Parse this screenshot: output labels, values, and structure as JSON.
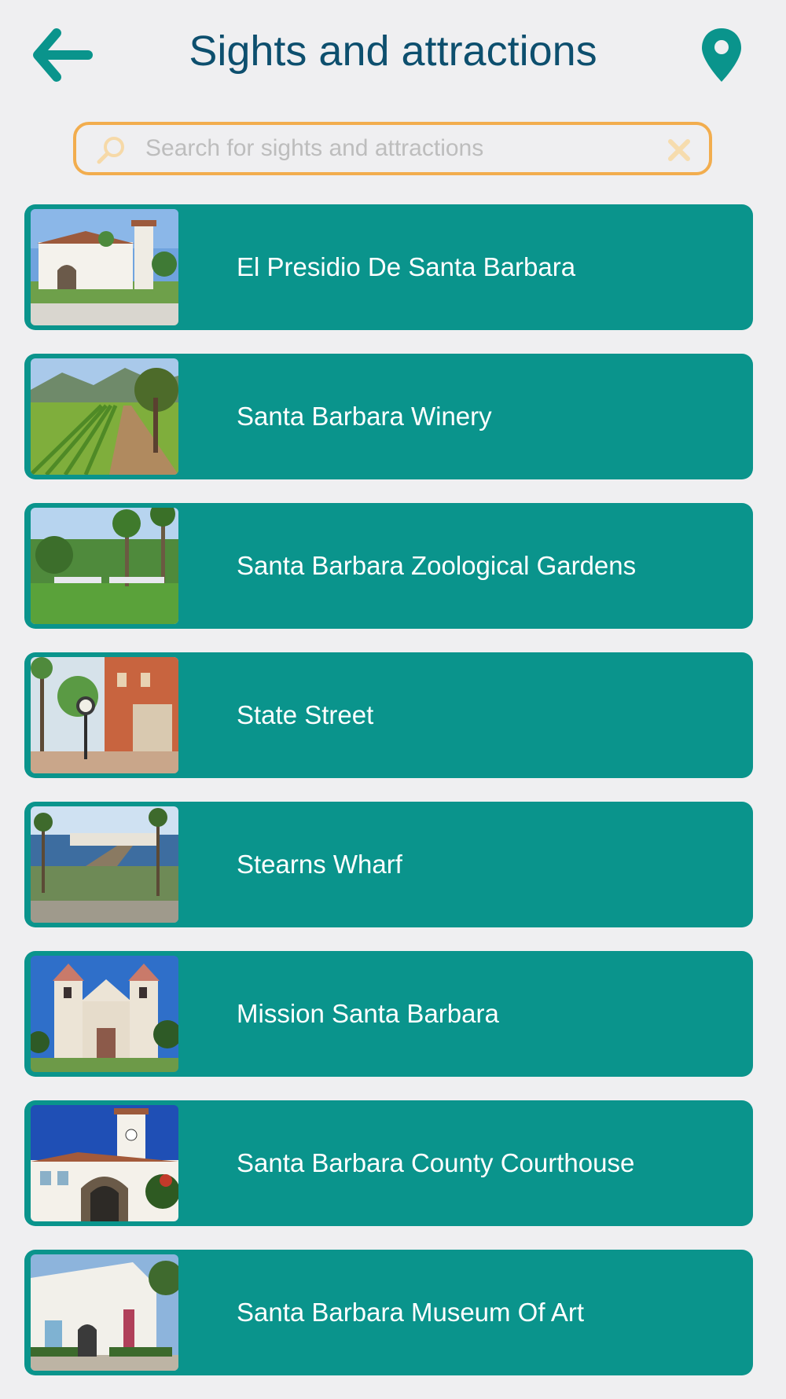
{
  "header": {
    "title": "Sights and attractions",
    "back_icon": "arrow-left-icon",
    "location_icon": "map-pin-icon"
  },
  "search": {
    "placeholder": "Search for sights and attractions",
    "value": "",
    "search_icon": "magnifier-icon",
    "clear_icon": "close-icon"
  },
  "colors": {
    "accent": "#0a948c",
    "title": "#0d4f6e",
    "search_border": "#f2ad4e",
    "background": "#efeff1"
  },
  "items": [
    {
      "label": "El Presidio De Santa Barbara"
    },
    {
      "label": "Santa Barbara Winery"
    },
    {
      "label": "Santa Barbara Zoological Gardens"
    },
    {
      "label": "State Street"
    },
    {
      "label": "Stearns Wharf"
    },
    {
      "label": "Mission Santa Barbara"
    },
    {
      "label": "Santa Barbara County Courthouse"
    },
    {
      "label": "Santa Barbara Museum Of Art"
    }
  ]
}
